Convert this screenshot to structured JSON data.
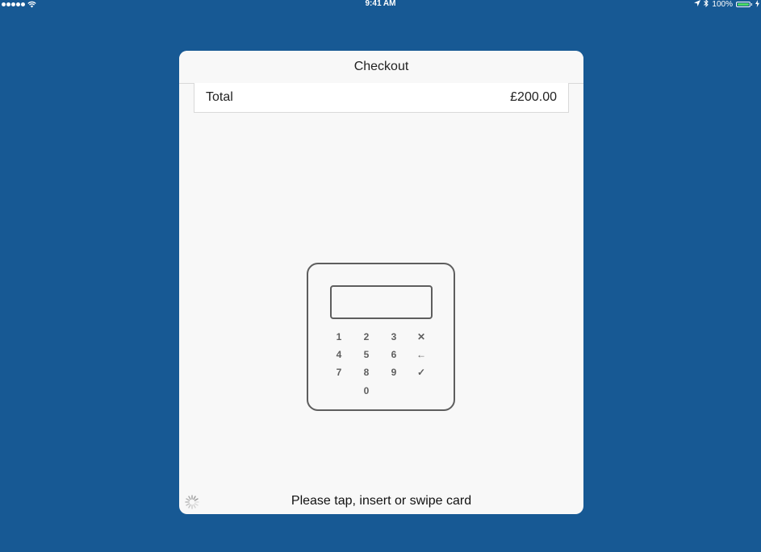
{
  "status_bar": {
    "time": "9:41 AM",
    "battery_text": "100%",
    "icons": [
      "signal-dots",
      "wifi-icon",
      "location-arrow-icon",
      "bluetooth-icon",
      "battery-icon",
      "charging-icon"
    ]
  },
  "modal": {
    "title": "Checkout",
    "total_label": "Total",
    "total_value": "£200.00",
    "prompt": "Please tap, insert or swipe card",
    "spinner_icon": "loading-spinner-icon"
  },
  "reader": {
    "keys": [
      [
        "1",
        "2",
        "3",
        "✕"
      ],
      [
        "4",
        "5",
        "6",
        "←"
      ],
      [
        "7",
        "8",
        "9",
        "✓"
      ],
      [
        "",
        "0",
        "",
        ""
      ]
    ],
    "key_names": [
      [
        "key-1",
        "key-2",
        "key-3",
        "key-cancel-icon"
      ],
      [
        "key-4",
        "key-5",
        "key-6",
        "key-back-icon"
      ],
      [
        "key-7",
        "key-8",
        "key-9",
        "key-confirm-icon"
      ],
      [
        "",
        "key-0",
        "",
        ""
      ]
    ]
  },
  "colors": {
    "background": "#175994",
    "modal": "#f8f8f8",
    "reader_outline": "#5e5e5e",
    "battery_fill": "#4cd964"
  }
}
